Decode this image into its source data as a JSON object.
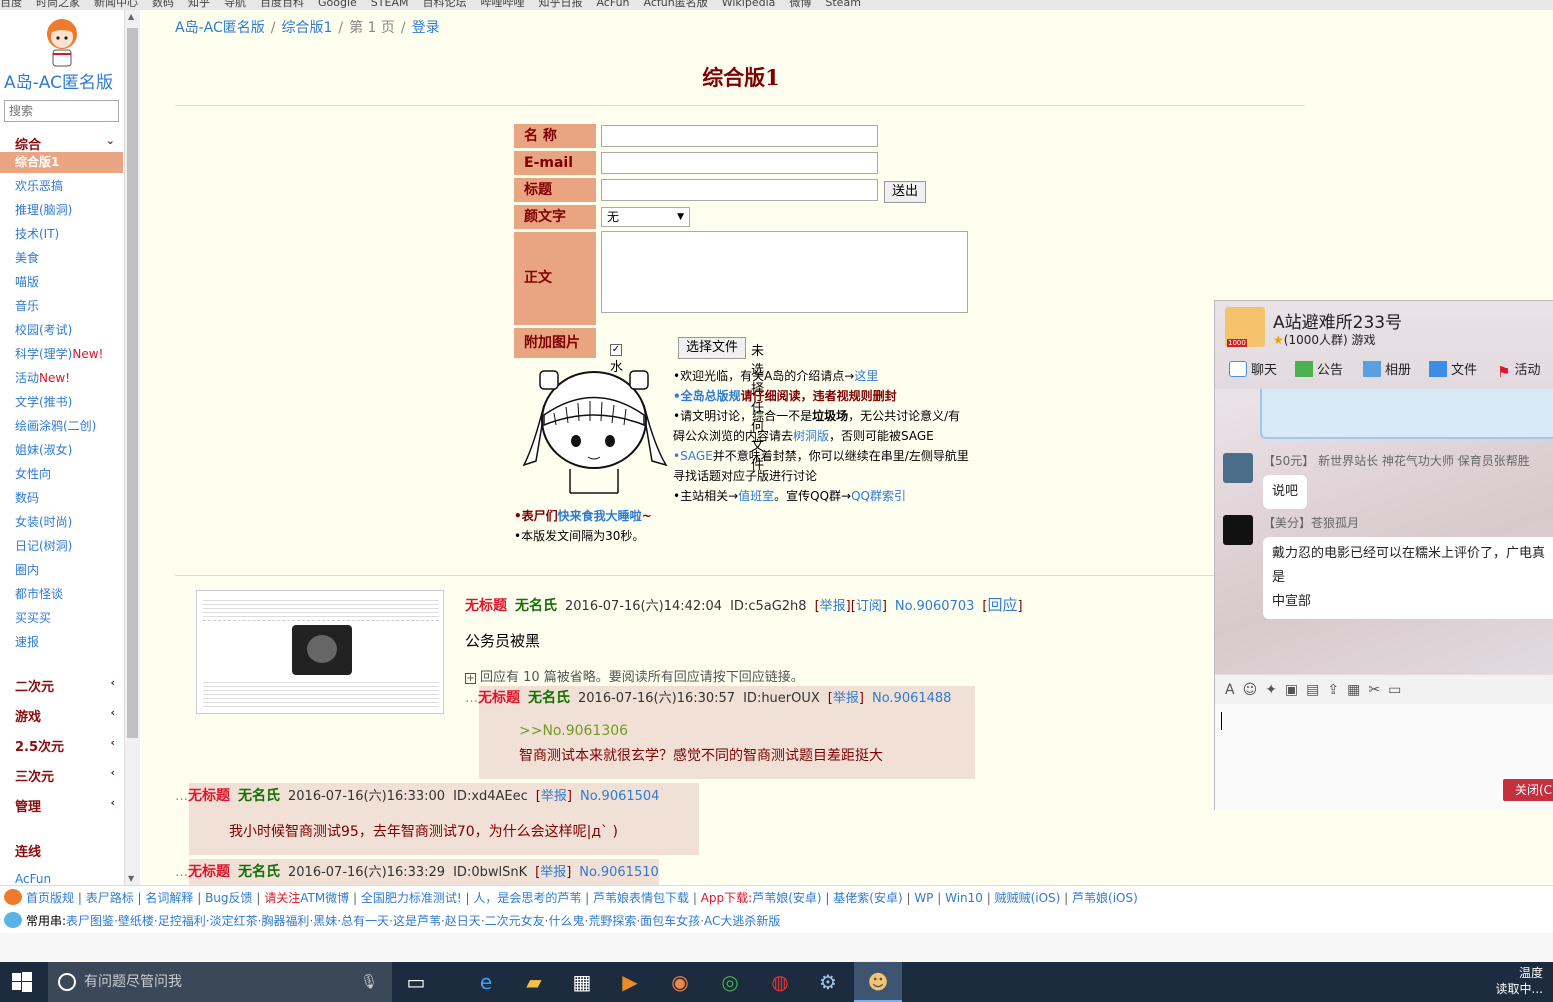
{
  "bookmarks": [
    "百度",
    "时尚之家",
    "新闻中心",
    "数码",
    "知乎",
    "导航",
    "百度百科",
    "Google",
    "STEAM",
    "百科论坛",
    "哔哩哔哩",
    "知乎日报",
    "AcFun",
    "Acfun匿名版",
    "Wikipedia",
    "微博",
    "Steam"
  ],
  "sidebar": {
    "site_name": "A岛-AC匿名版",
    "search_placeholder": "搜索",
    "categories": [
      {
        "label": "综合",
        "chevron": "⌄"
      },
      {
        "label": "二次元",
        "chevron": "‹"
      },
      {
        "label": "游戏",
        "chevron": "‹"
      },
      {
        "label": "2.5次元",
        "chevron": "‹"
      },
      {
        "label": "三次元",
        "chevron": "‹"
      },
      {
        "label": "管理",
        "chevron": "‹"
      },
      {
        "label": "连线",
        "chevron": ""
      }
    ],
    "boards": [
      {
        "label": "综合版1"
      },
      {
        "label": "欢乐恶搞"
      },
      {
        "label": "推理(脑洞)"
      },
      {
        "label": "技术(IT)"
      },
      {
        "label": "美食"
      },
      {
        "label": "喵版"
      },
      {
        "label": "音乐"
      },
      {
        "label": "校园(考试)"
      },
      {
        "label": "科学(理学)",
        "new": "New!"
      },
      {
        "label": "活动",
        "new": "New!"
      },
      {
        "label": "文学(推书)"
      },
      {
        "label": "绘画涂鸦(二创)"
      },
      {
        "label": "姐妹(淑女)"
      },
      {
        "label": "女性向"
      },
      {
        "label": "数码"
      },
      {
        "label": "女装(时尚)"
      },
      {
        "label": "日记(树洞)"
      },
      {
        "label": "圈内"
      },
      {
        "label": "都市怪谈"
      },
      {
        "label": "买买买"
      },
      {
        "label": "速报"
      }
    ],
    "link_acfun": "AcFun"
  },
  "breadcrumb": {
    "home": "A岛-AC匿名版",
    "board": "综合版1",
    "page": "第 1 页",
    "login": "登录"
  },
  "board_title": "综合版1",
  "form": {
    "name_label": "名 称",
    "email_label": "E-mail",
    "title_label": "标题",
    "send_label": "送出",
    "kaomoji_label": "颜文字",
    "kaomoji_value": "无",
    "body_label": "正文",
    "image_label": "附加图片",
    "watermark_label": "水印",
    "file_button": "选择文件",
    "no_file": "未选择任何文件"
  },
  "rules": {
    "r1_pre": "•欢迎光临，有关A岛的介绍请点→",
    "r1_link": "这里",
    "r2_link": "•全岛总版规",
    "r2_post": "请仔细阅读，违者视规则删封",
    "r3_a": "•请文明讨论，综合一不是",
    "r3_b": "垃圾场",
    "r3_c": "，无公共讨论意义/有",
    "r3d_a": "碍公众浏览的内容请去",
    "r3d_link": "树洞版",
    "r3d_b": "，否则可能被SAGE",
    "r4_link": "•SAGE",
    "r4_post": "并不意味着封禁，你可以继续在串里/左侧导航里",
    "r4b": "寻找话题对应子版进行讨论",
    "r5_pre": "•主站相关→",
    "r5_link1": "值班室",
    "r5_mid": "。宣传QQ群→",
    "r5_link2": "QQ群索引",
    "r6_pre": "•表尸们",
    "r6_link": "快来食我大睡啦",
    "r6_post": "~",
    "r7": "•本版发文间隔为30秒。"
  },
  "thread": {
    "title": "无标题",
    "name": "无名氏",
    "time": "2016-07-16(六)14:42:04",
    "id": "ID:c5aG2h8",
    "report": "举报",
    "subscribe": "订阅",
    "no": "No.9060703",
    "reply": "回应",
    "content": "公务员被黑",
    "omitted": "回应有 10 篇被省略。要阅读所有回应请按下回应链接。"
  },
  "replies": [
    {
      "title": "无标题",
      "name": "无名氏",
      "time": "2016-07-16(六)16:30:57",
      "id": "ID:huerOUX",
      "report": "举报",
      "no": "No.9061488",
      "quote": ">>No.9061306",
      "text": "智商测试本来就很玄学？感觉不同的智商测试题目差距挺大"
    },
    {
      "title": "无标题",
      "name": "无名氏",
      "time": "2016-07-16(六)16:33:00",
      "id": "ID:xd4AEec",
      "report": "举报",
      "no": "No.9061504",
      "text": "我小时候智商测试95，去年智商测试70，为什么会这样呢|д` )"
    },
    {
      "title": "无标题",
      "name": "无名氏",
      "time": "2016-07-16(六)16:33:29",
      "id": "ID:0bwlSnK",
      "report": "举报",
      "no": "No.9061510"
    }
  ],
  "footer": {
    "row1": [
      {
        "t": "首页版规"
      },
      {
        "t": "表尸路标"
      },
      {
        "t": "名词解释"
      },
      {
        "t": "Bug反馈"
      },
      {
        "t": "请关注",
        "red": true
      },
      {
        "t": "ATM微博"
      },
      {
        "t": "全国肥力标准测试!"
      },
      {
        "t": "人，是会思考的芦苇"
      },
      {
        "t": "芦苇娘表情包下载"
      },
      {
        "t": "App下载:",
        "red": true
      },
      {
        "t": "芦苇娘(安卓)"
      },
      {
        "t": "基佬紫(安卓)"
      },
      {
        "t": "WP"
      },
      {
        "t": "Win10"
      },
      {
        "t": "贼贼贼(iOS)"
      },
      {
        "t": "芦苇娘(iOS)"
      }
    ],
    "row2_label": "常用串:",
    "row2": [
      "表尸图鉴",
      "壁纸楼",
      "足控福利",
      "淡定红茶",
      "胸器福利",
      "黑妹",
      "总有一天",
      "这是芦苇",
      "赵日天",
      "二次元女友",
      "什么鬼",
      "荒野探索",
      "面包车女孩",
      "AC大逃杀新版"
    ]
  },
  "taskbar": {
    "search_text": "有问题尽管问我",
    "tray_line1": "温度",
    "tray_line2": "读取中..."
  },
  "qq": {
    "group_name": "A站避难所233号",
    "group_sub": "(1000人群) 游戏",
    "avatar_badge": "1000",
    "tabs": [
      "聊天",
      "公告",
      "相册",
      "文件",
      "活动"
    ],
    "msg1_meta": "【50元】 新世界站长 神花气功大师 保育员张帮胜",
    "msg1_text": "说吧",
    "msg2_meta": "【美分】苍狼孤月",
    "msg2_text_a": "戴力忍的电影已经可以在糯米上评价了，广电真是",
    "msg2_text_b": "中宣部",
    "close_label": "关闭(C"
  },
  "colors": {
    "accent": "#e9a581",
    "link": "#2f7bd2",
    "title_red": "#e0142a",
    "name_green": "#157002",
    "reply_bg": "#f0e0d6",
    "bg_cream": "#fffff0"
  }
}
